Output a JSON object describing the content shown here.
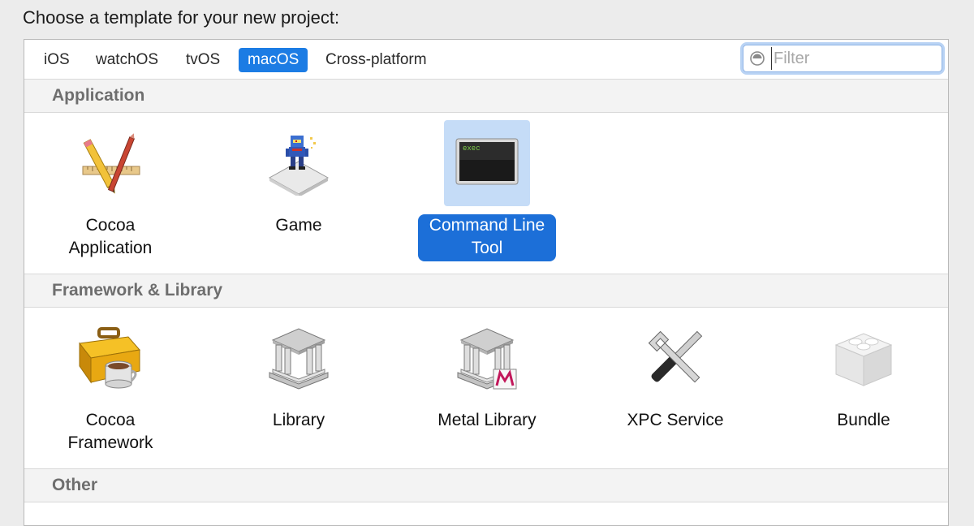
{
  "heading": "Choose a template for your new project:",
  "tabs": [
    {
      "label": "iOS",
      "selected": false
    },
    {
      "label": "watchOS",
      "selected": false
    },
    {
      "label": "tvOS",
      "selected": false
    },
    {
      "label": "macOS",
      "selected": true
    },
    {
      "label": "Cross-platform",
      "selected": false
    }
  ],
  "filter": {
    "placeholder": "Filter",
    "value": "",
    "icon": "filter-icon"
  },
  "sections": [
    {
      "title": "Application",
      "items": [
        {
          "label": "Cocoa\nApplication",
          "icon": "pencil-ruler-icon",
          "selected": false
        },
        {
          "label": "Game",
          "icon": "game-icon",
          "selected": false
        },
        {
          "label": "Command Line\nTool",
          "icon": "terminal-icon",
          "icon_text": "exec",
          "selected": true
        }
      ]
    },
    {
      "title": "Framework & Library",
      "items": [
        {
          "label": "Cocoa\nFramework",
          "icon": "toolbox-icon",
          "selected": false
        },
        {
          "label": "Library",
          "icon": "library-building-icon",
          "selected": false
        },
        {
          "label": "Metal Library",
          "icon": "metal-library-icon",
          "selected": false
        },
        {
          "label": "XPC Service",
          "icon": "tools-icon",
          "selected": false
        },
        {
          "label": "Bundle",
          "icon": "bundle-icon",
          "selected": false
        }
      ]
    },
    {
      "title": "Other",
      "items": []
    }
  ],
  "colors": {
    "accent": "#1c7ce4",
    "selection_bg": "#c5dcf7",
    "section_text": "#6e6e6e"
  }
}
